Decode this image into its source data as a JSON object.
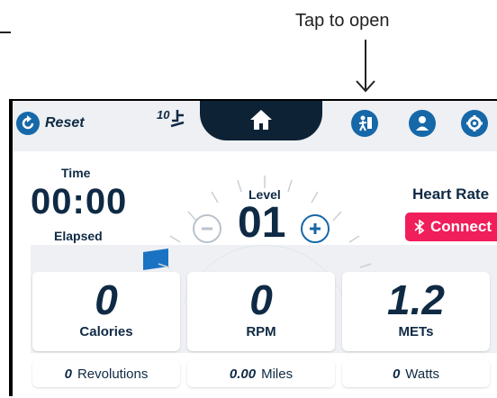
{
  "annotation": {
    "tap_text": "Tap to open"
  },
  "topbar": {
    "reset_label": "Reset",
    "incline_value": "10",
    "icons": [
      "refresh-icon",
      "incline-icon",
      "home-icon",
      "workout-icon",
      "user-icon",
      "gear-icon"
    ]
  },
  "time": {
    "label": "Time",
    "value": "00:00",
    "sublabel": "Elapsed"
  },
  "level": {
    "label": "Level",
    "value": "01"
  },
  "heart_rate": {
    "label": "Heart Rate",
    "connect_label": "Connect"
  },
  "stats": [
    {
      "value": "0",
      "label": "Calories"
    },
    {
      "value": "0",
      "label": "RPM"
    },
    {
      "value": "1.2",
      "label": "METs"
    }
  ],
  "mini_stats": [
    {
      "value": "0",
      "label": "Revolutions"
    },
    {
      "value": "0.00",
      "label": "Miles"
    },
    {
      "value": "0",
      "label": "Watts"
    }
  ],
  "colors": {
    "navy": "#0f2a44",
    "blue": "#1668a8",
    "connect": "#f01e5a",
    "panel": "#eef0f3"
  }
}
